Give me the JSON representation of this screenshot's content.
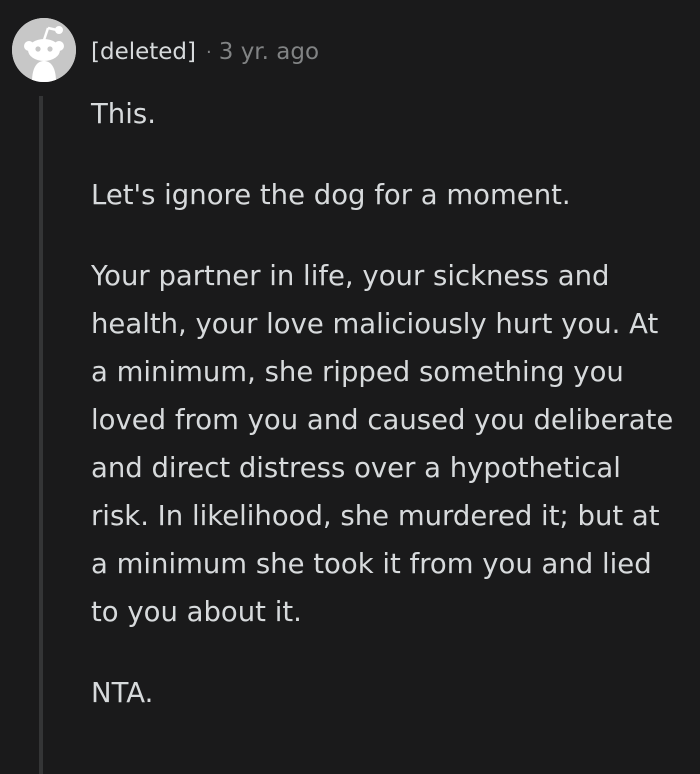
{
  "comment": {
    "author": "[deleted]",
    "separator": "·",
    "timestamp": "3 yr. ago",
    "avatar_icon": "reddit-snoo-avatar-icon",
    "paragraphs": [
      "This.",
      "Let's ignore the dog for a moment.",
      "Your partner in life, your sickness and health, your love maliciously hurt you. At a minimum, she ripped something you loved from you and caused you deliberate and direct distress over a hypothetical risk. In likelihood, she murdered it; but at a minimum she took it from you and lied to you about it.",
      "NTA."
    ]
  },
  "colors": {
    "background": "#1a1a1b",
    "text": "#d7dadc",
    "meta": "#818384",
    "thread_line": "#343536",
    "avatar_bg": "#c7c7c7"
  }
}
